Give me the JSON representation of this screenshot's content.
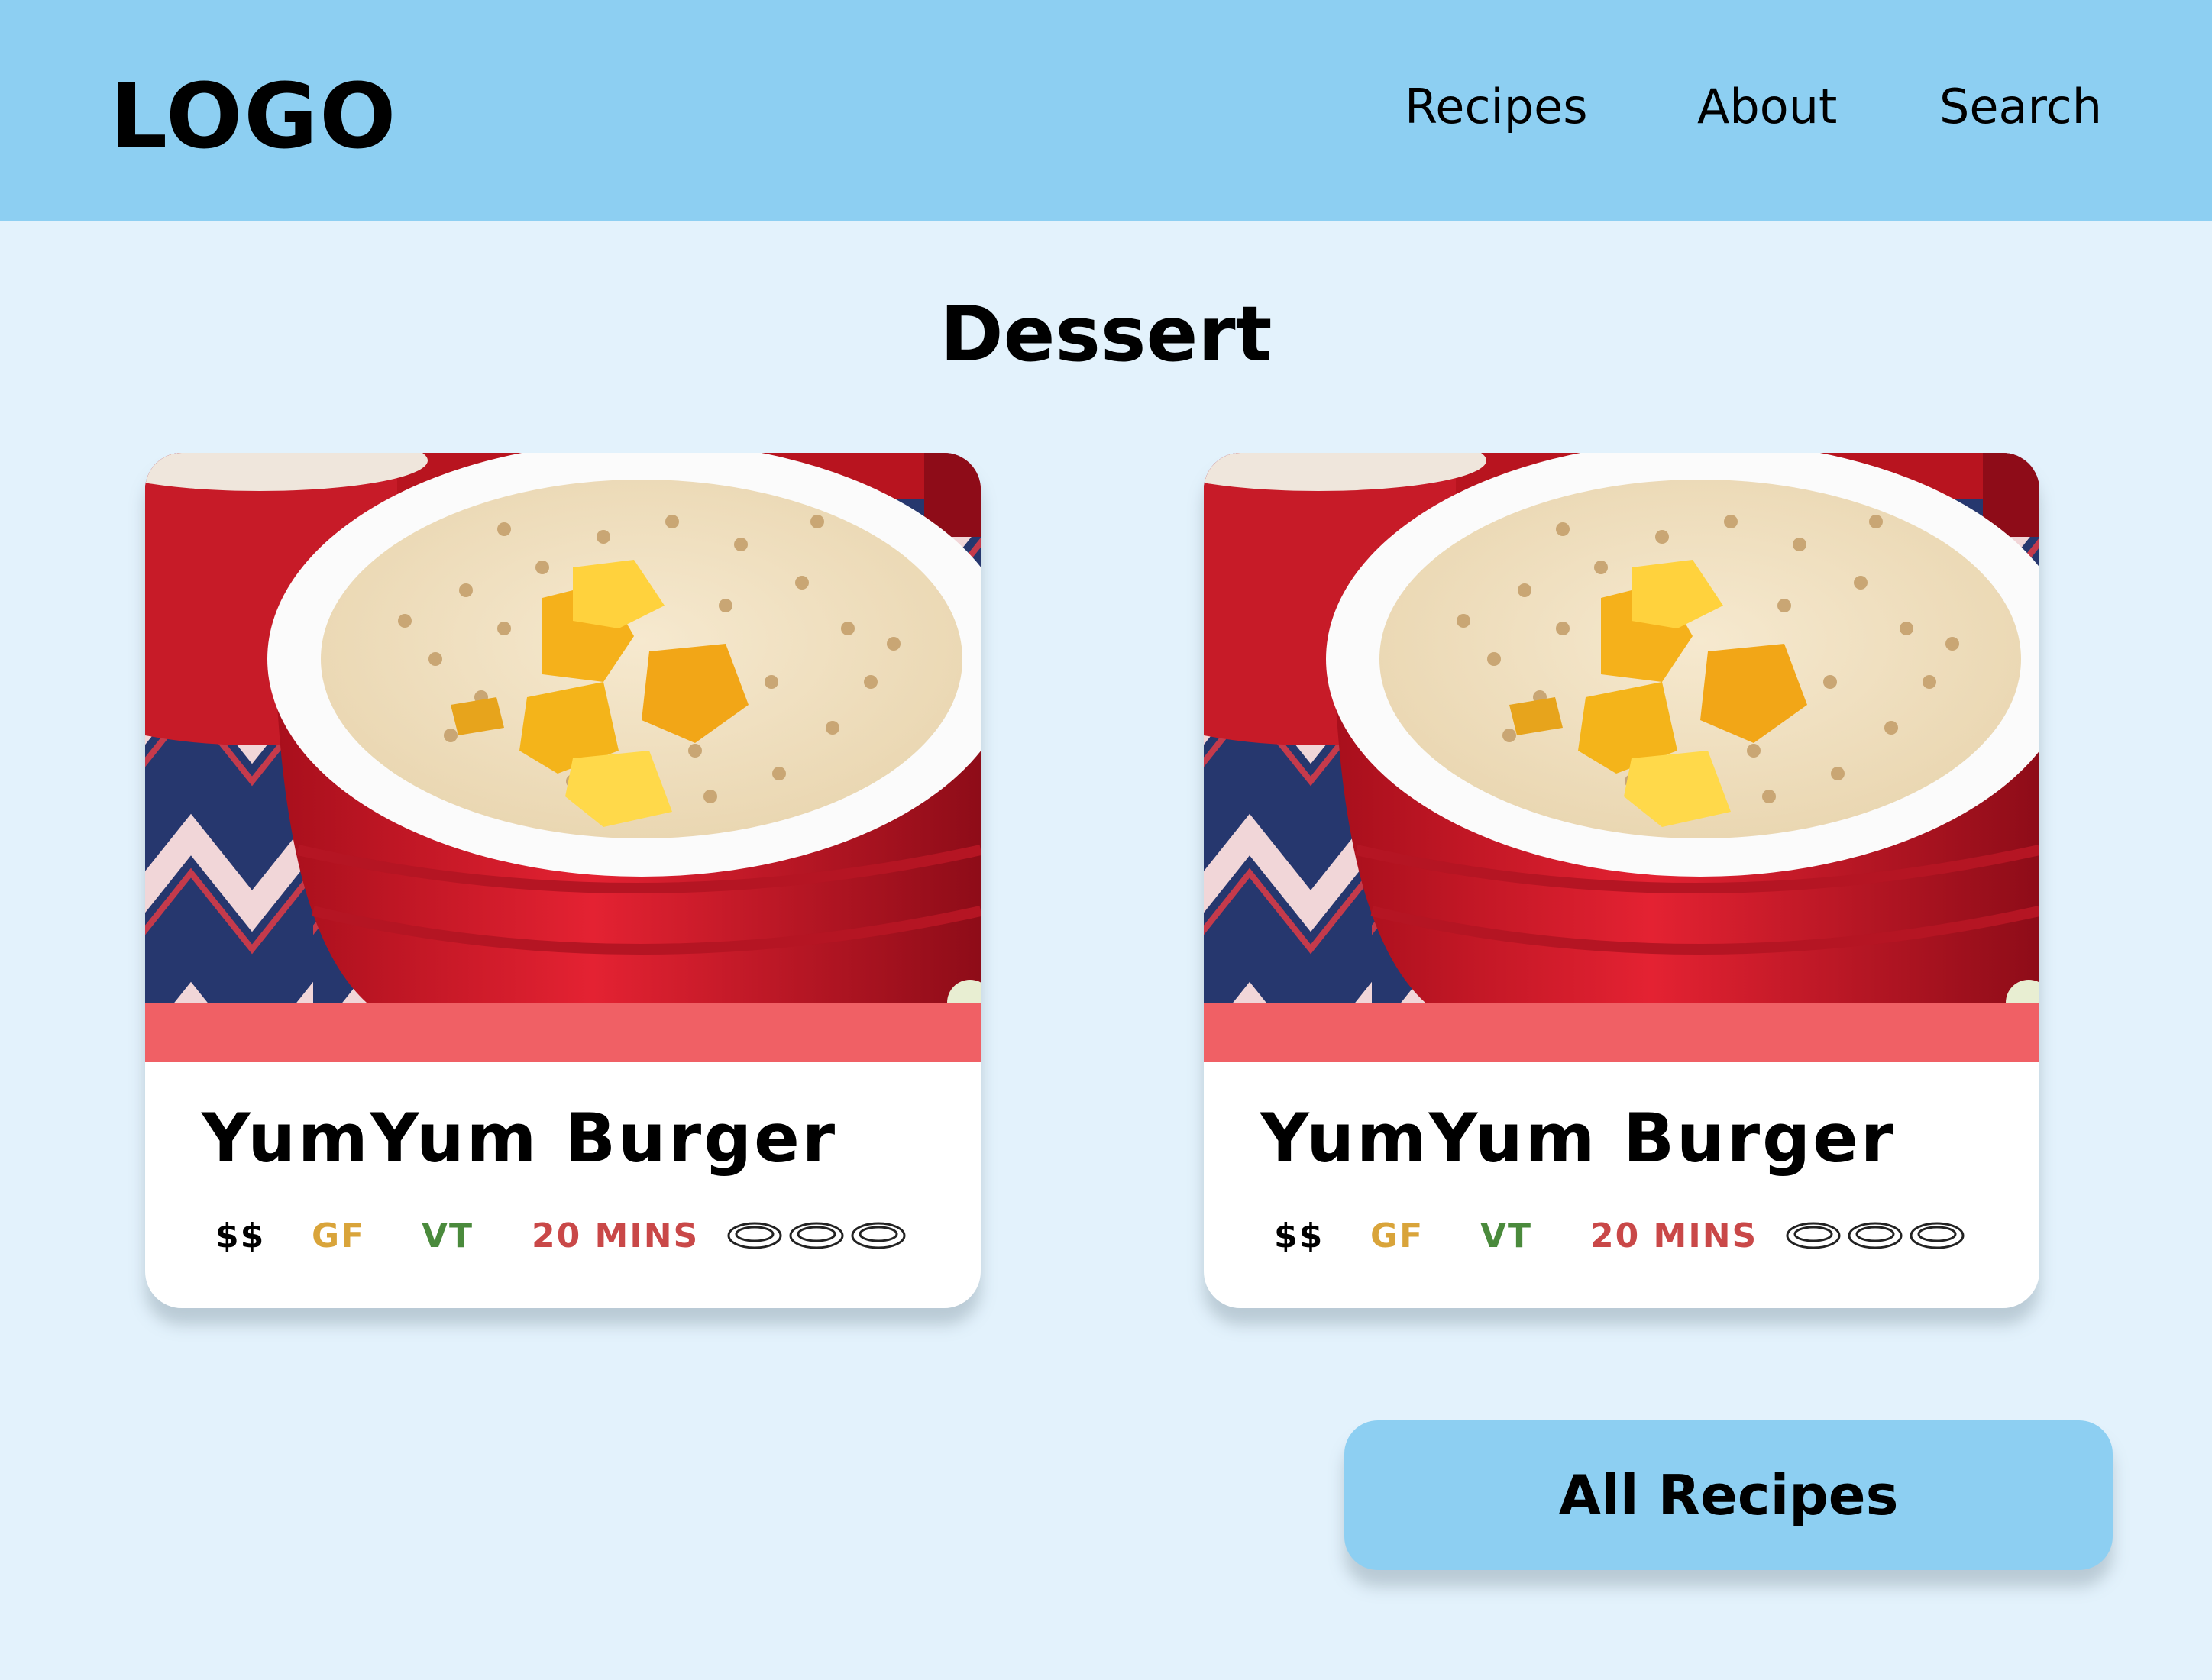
{
  "header": {
    "logo": "LOGO",
    "nav": {
      "recipes": "Recipes",
      "about": "About",
      "search": "Search"
    },
    "background_color": "#8dcff2"
  },
  "section": {
    "title": "Dessert"
  },
  "cards": [
    {
      "title": "YumYum Burger",
      "price": "$$",
      "gluten_free": "GF",
      "vegetarian": "VT",
      "time": "20 MINS",
      "serving_icon": "plate-icon",
      "servings": 3,
      "stripe_color": "#f06065"
    },
    {
      "title": "YumYum Burger",
      "price": "$$",
      "gluten_free": "GF",
      "vegetarian": "VT",
      "time": "20 MINS",
      "serving_icon": "plate-icon",
      "servings": 3,
      "stripe_color": "#f06065"
    }
  ],
  "button": {
    "label": "All Recipes",
    "color": "#8dcff2"
  },
  "colors": {
    "page_background": "#e3f2fc",
    "gf": "#d9a43a",
    "vt": "#4a8a3c",
    "time": "#c94848"
  }
}
